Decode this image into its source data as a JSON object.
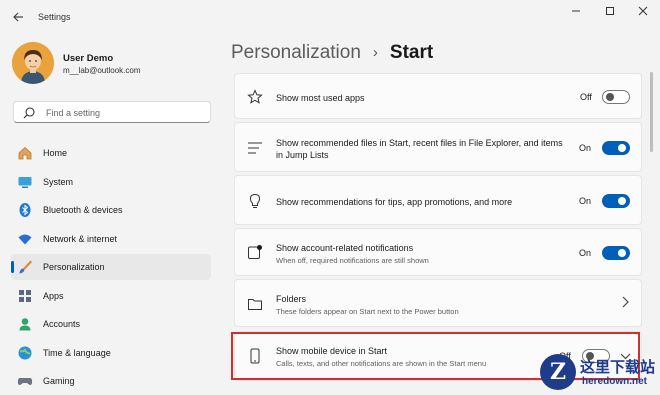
{
  "window": {
    "title": "Settings",
    "controls": [
      "minimize",
      "maximize",
      "close"
    ]
  },
  "user": {
    "name": "User Demo",
    "email": "m__lab@outlook.com"
  },
  "search": {
    "placeholder": "Find a setting"
  },
  "sidebar": {
    "items": [
      {
        "label": "Home",
        "icon": "home-icon",
        "active": false
      },
      {
        "label": "System",
        "icon": "system-icon",
        "active": false
      },
      {
        "label": "Bluetooth & devices",
        "icon": "bluetooth-icon",
        "active": false
      },
      {
        "label": "Network & internet",
        "icon": "wifi-icon",
        "active": false
      },
      {
        "label": "Personalization",
        "icon": "brush-icon",
        "active": true
      },
      {
        "label": "Apps",
        "icon": "apps-icon",
        "active": false
      },
      {
        "label": "Accounts",
        "icon": "accounts-icon",
        "active": false
      },
      {
        "label": "Time & language",
        "icon": "globe-icon",
        "active": false
      },
      {
        "label": "Gaming",
        "icon": "gamepad-icon",
        "active": false
      }
    ]
  },
  "header": {
    "parent": "Personalization",
    "separator": "›",
    "current": "Start"
  },
  "settings": [
    {
      "title": "Show most used apps",
      "state": "Off",
      "on": false
    },
    {
      "title": "Show recommended files in Start, recent files in File Explorer, and items in Jump Lists",
      "state": "On",
      "on": true
    },
    {
      "title": "Show recommendations for tips, app promotions, and more",
      "state": "On",
      "on": true
    },
    {
      "title": "Show account-related notifications",
      "subtitle": "When off, required notifications are still shown",
      "state": "On",
      "on": true
    },
    {
      "title": "Folders",
      "subtitle": "These folders appear on Start next to the Power button"
    },
    {
      "title": "Show mobile device in Start",
      "subtitle": "Calls, texts, and other notifications are shown in the Start menu",
      "state": "Off",
      "on": false
    }
  ],
  "watermark": {
    "logo_letter": "Z",
    "line1": "这里下载站",
    "line2": "heredown.net"
  },
  "colors": {
    "accent": "#005fb8",
    "highlight": "#d32f2f",
    "background": "#f3f3f3"
  }
}
